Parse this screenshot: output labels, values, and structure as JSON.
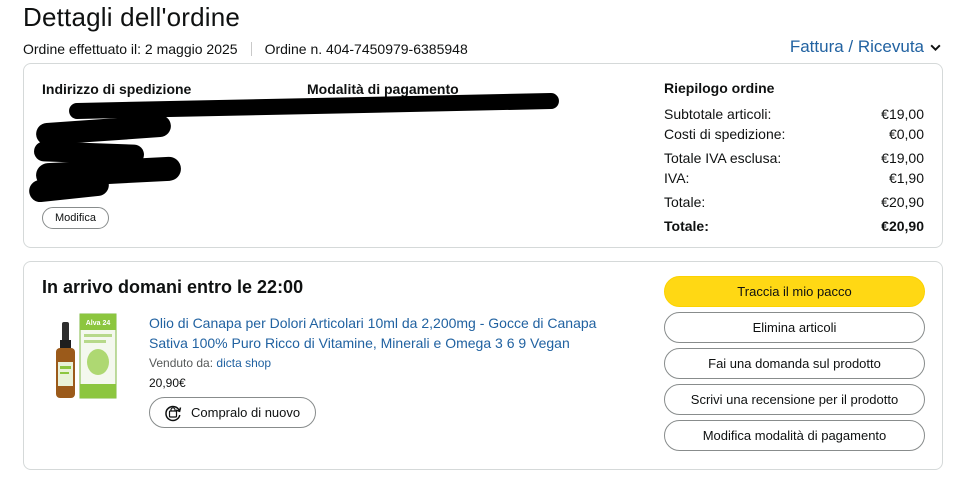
{
  "page": {
    "title": "Dettagli dell'ordine"
  },
  "meta": {
    "order_date": "Ordine effettuato il: 2 maggio 2025",
    "order_number": "Ordine n. 404-7450979-6385948"
  },
  "invoice": {
    "label": "Fattura / Ricevuta",
    "icon": "chevron-down-icon"
  },
  "info": {
    "shipping_heading": "Indirizzo di spedizione",
    "payment_heading": "Modalità di pagamento",
    "edit_label": "Modifica"
  },
  "summary": {
    "title": "Riepilogo ordine",
    "rows": [
      {
        "label": "Subtotale articoli:",
        "value": "€19,00"
      },
      {
        "label": "Costi di spedizione:",
        "value": "€0,00"
      },
      {
        "label": "Totale IVA esclusa:",
        "value": "€19,00"
      },
      {
        "label": "IVA:",
        "value": "€1,90"
      },
      {
        "label": "Totale:",
        "value": "€20,90"
      }
    ],
    "grand_total": {
      "label": "Totale:",
      "value": "€20,90"
    }
  },
  "shipment": {
    "status": "In arrivo domani entro le 22:00",
    "product": {
      "title": "Olio di Canapa per Dolori Articolari 10ml da 2,200mg - Gocce di Canapa Sativa 100% Puro Ricco di Vitamine, Minerali e Omega 3 6 9 Vegan",
      "sold_by_label": "Venduto da:",
      "seller": "dicta shop",
      "price": "20,90€",
      "buy_again_label": "Compralo di nuovo",
      "box_brand": "Alva 24"
    },
    "actions": {
      "track": "Traccia il mio pacco",
      "remove": "Elimina articoli",
      "question": "Fai una domanda sul prodotto",
      "review": "Scrivi una recensione per il prodotto",
      "payment": "Modifica modalità di pagamento"
    }
  },
  "colors": {
    "link": "#2162a1",
    "primary_button": "#ffd814",
    "border": "#d5d9d9"
  }
}
